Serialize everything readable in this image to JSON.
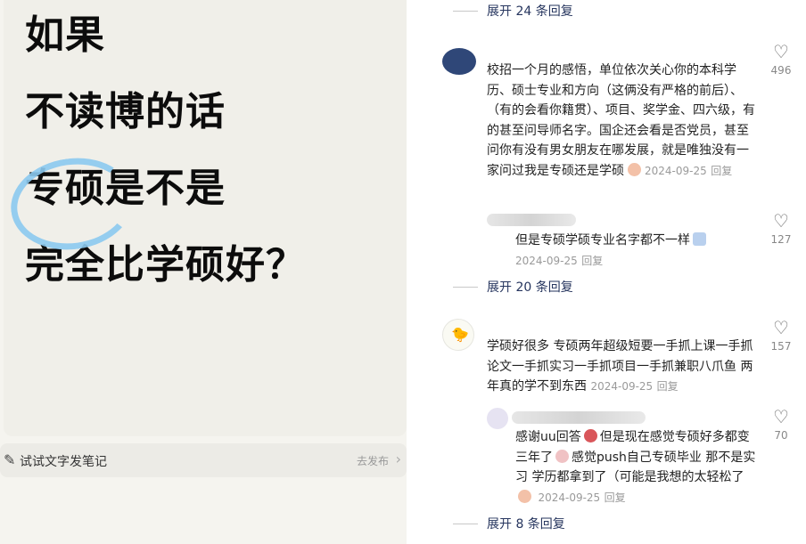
{
  "post": {
    "lines": [
      "如果",
      "不读博的话",
      "专硕是不是",
      "完全比学硕好？"
    ],
    "note_hint": "试试文字发笔记",
    "publish_label": "去发布"
  },
  "comments": {
    "top_expand": "展开 24 条回复",
    "c1": {
      "text": "校招一个月的感悟，单位依次关心你的本科学历、硕士专业和方向（这俩没有严格的前后）、（有的会看你籍贯）、项目、奖学金、四六级，有的甚至问导师名字。国企还会看是否党员，甚至问你有没有男女朋友在哪发展，就是唯独没有一家问过我是专硕还是学硕",
      "date": "2024-09-25",
      "reply": "回复",
      "likes": "496"
    },
    "c1r": {
      "text": "但是专硕学硕专业名字都不一样",
      "date": "2024-09-25",
      "reply": "回复",
      "likes": "127"
    },
    "c1_expand": "展开 20 条回复",
    "c2": {
      "text": "学硕好很多 专硕两年超级短要一手抓上课一手抓论文一手抓实习一手抓项目一手抓兼职八爪鱼 两年真的学不到东西",
      "date": "2024-09-25",
      "reply": "回复",
      "likes": "157"
    },
    "c2r": {
      "text1": "感谢uu回答",
      "text2": "但是现在感觉专硕好多都变三年了",
      "text3": "感觉push自己专硕毕业 那不是实习 学历都拿到了（可能是我想的太轻松了",
      "date": "2024-09-25",
      "reply": "回复",
      "likes": "70"
    },
    "c2_expand": "展开 8 条回复"
  },
  "colors": {
    "accent_link": "#2d3d64",
    "circle": "#8ccaf0",
    "post_bg": "#f0efe9"
  }
}
